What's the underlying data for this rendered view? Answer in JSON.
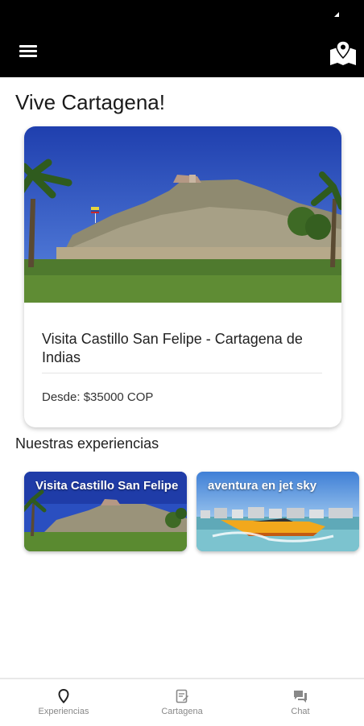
{
  "status_bar": {
    "icon": "signal-icon"
  },
  "app_bar": {
    "menu_icon": "hamburger-menu-icon",
    "map_icon": "map-icon"
  },
  "page": {
    "title": "Vive Cartagena!"
  },
  "featured": {
    "title": "Visita Castillo San Felipe - Cartagena de Indias",
    "price": "Desde: $35000 COP",
    "image": "castle-photo"
  },
  "experiences": {
    "title": "Nuestras experiencias",
    "items": [
      {
        "label": "Visita Castillo San Felipe",
        "image": "castle-photo"
      },
      {
        "label": "aventura en jet sky",
        "image": "jet-boat-photo"
      }
    ]
  },
  "bottom_nav": {
    "items": [
      {
        "label": "Experiencias",
        "icon": "location-pin-icon"
      },
      {
        "label": "Cartagena",
        "icon": "document-edit-icon"
      },
      {
        "label": "Chat",
        "icon": "chat-bubble-icon"
      }
    ]
  },
  "colors": {
    "app_bar": "#000000",
    "background": "#ffffff",
    "nav_text": "#888888"
  }
}
